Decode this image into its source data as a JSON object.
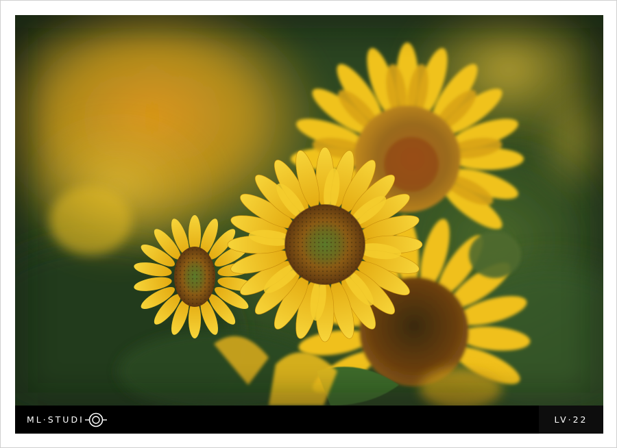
{
  "photo": {
    "subject": "sunflower-field",
    "colors": {
      "petal": "#f2c21a",
      "petal_shadow": "#c98f0a",
      "disc": "#7a4a12",
      "disc_center": "#4f6a22",
      "leaf": "#2f4a22",
      "blur_orange": "#e09a1e"
    }
  },
  "footer": {
    "brand_text": "ML·STUDI",
    "brand_icon": "lens-o-icon",
    "code": "LV·22"
  }
}
